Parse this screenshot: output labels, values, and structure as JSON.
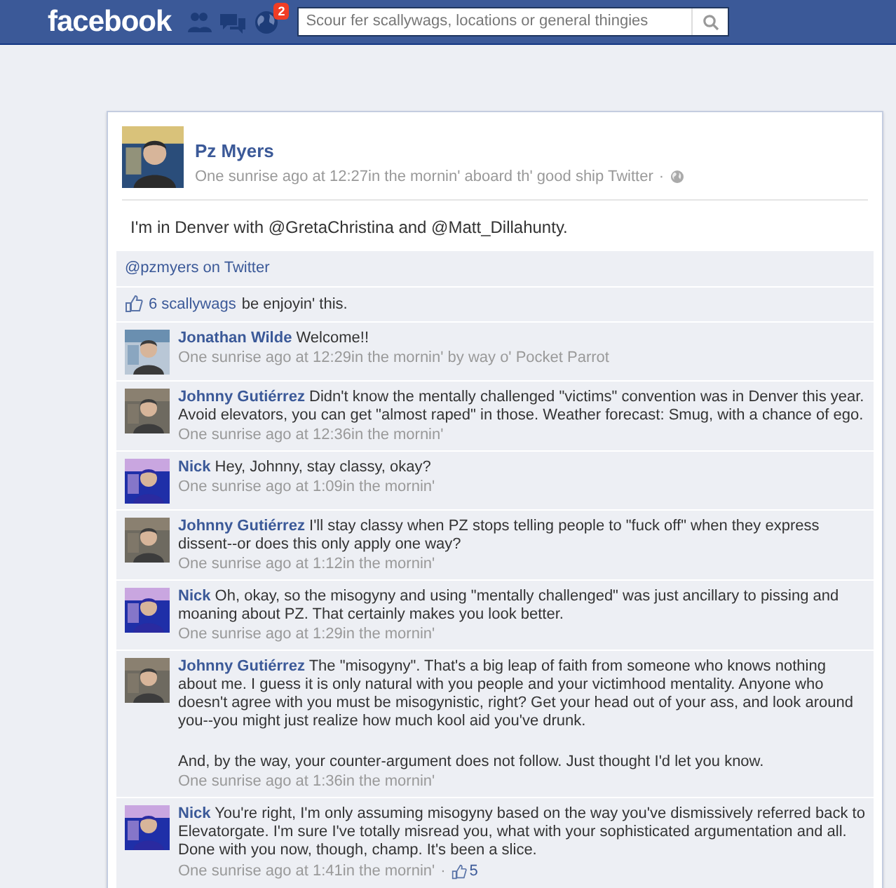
{
  "header": {
    "logo": "facebook",
    "notifications": {
      "badge": "2"
    },
    "search": {
      "placeholder": "Scour fer scallywags, locations or general thingies"
    }
  },
  "post": {
    "author": "Pz Myers",
    "meta": "One sunrise ago at 12:27in the mornin' aboard th' good ship Twitter",
    "meta_separator": "·",
    "text": "I'm in Denver with @GretaChristina and @Matt_Dillahunty.",
    "source_link": "@pzmyers on Twitter",
    "likes": {
      "link": "6 scallywags",
      "rest": "be enjoyin' this."
    }
  },
  "comments": [
    {
      "author": "Jonathan Wilde",
      "paragraphs": [
        "Welcome!!"
      ],
      "meta": "One sunrise ago at 12:29in the mornin' by way o' Pocket Parrot"
    },
    {
      "author": "Johnny Gutiérrez",
      "paragraphs": [
        "Didn't know the mentally challenged \"victims\" convention was in Denver this year. Avoid elevators, you can get \"almost raped\" in those. Weather forecast: Smug, with a chance of ego."
      ],
      "meta": "One sunrise ago at 12:36in the mornin'"
    },
    {
      "author": "Nick",
      "paragraphs": [
        "Hey, Johnny, stay classy, okay?"
      ],
      "meta": "One sunrise ago at 1:09in the mornin'"
    },
    {
      "author": "Johnny Gutiérrez",
      "paragraphs": [
        "I'll stay classy when PZ stops telling people to \"fuck off\" when they express dissent--or does this only apply one way?"
      ],
      "meta": "One sunrise ago at 1:12in the mornin'"
    },
    {
      "author": "Nick",
      "paragraphs": [
        "Oh, okay, so the misogyny and using \"mentally challenged\" was just ancillary to pissing and moaning about PZ. That certainly makes you look better."
      ],
      "meta": "One sunrise ago at 1:29in the mornin'"
    },
    {
      "author": "Johnny Gutiérrez",
      "paragraphs": [
        "The \"misogyny\". That's a big leap of faith from someone who knows nothing about me. I guess it is only natural with you people and your victimhood mentality. Anyone who doesn't agree with you must be misogynistic, right? Get your head out of your ass, and look around you--you might just realize how much kool aid you've drunk.",
        "And, by the way, your counter-argument does not follow. Just thought I'd let you know."
      ],
      "meta": "One sunrise ago at 1:36in the mornin'"
    },
    {
      "author": "Nick",
      "paragraphs": [
        "You're right, I'm only assuming misogyny based on the way you've dismissively referred back to Elevatorgate. I'm sure I've totally misread you, what with your sophisticated argumentation and all. Done with you now, though, champ. It's been a slice."
      ],
      "meta": "One sunrise ago at 1:41in the mornin'",
      "meta_separator": "·",
      "likes": "5"
    }
  ]
}
